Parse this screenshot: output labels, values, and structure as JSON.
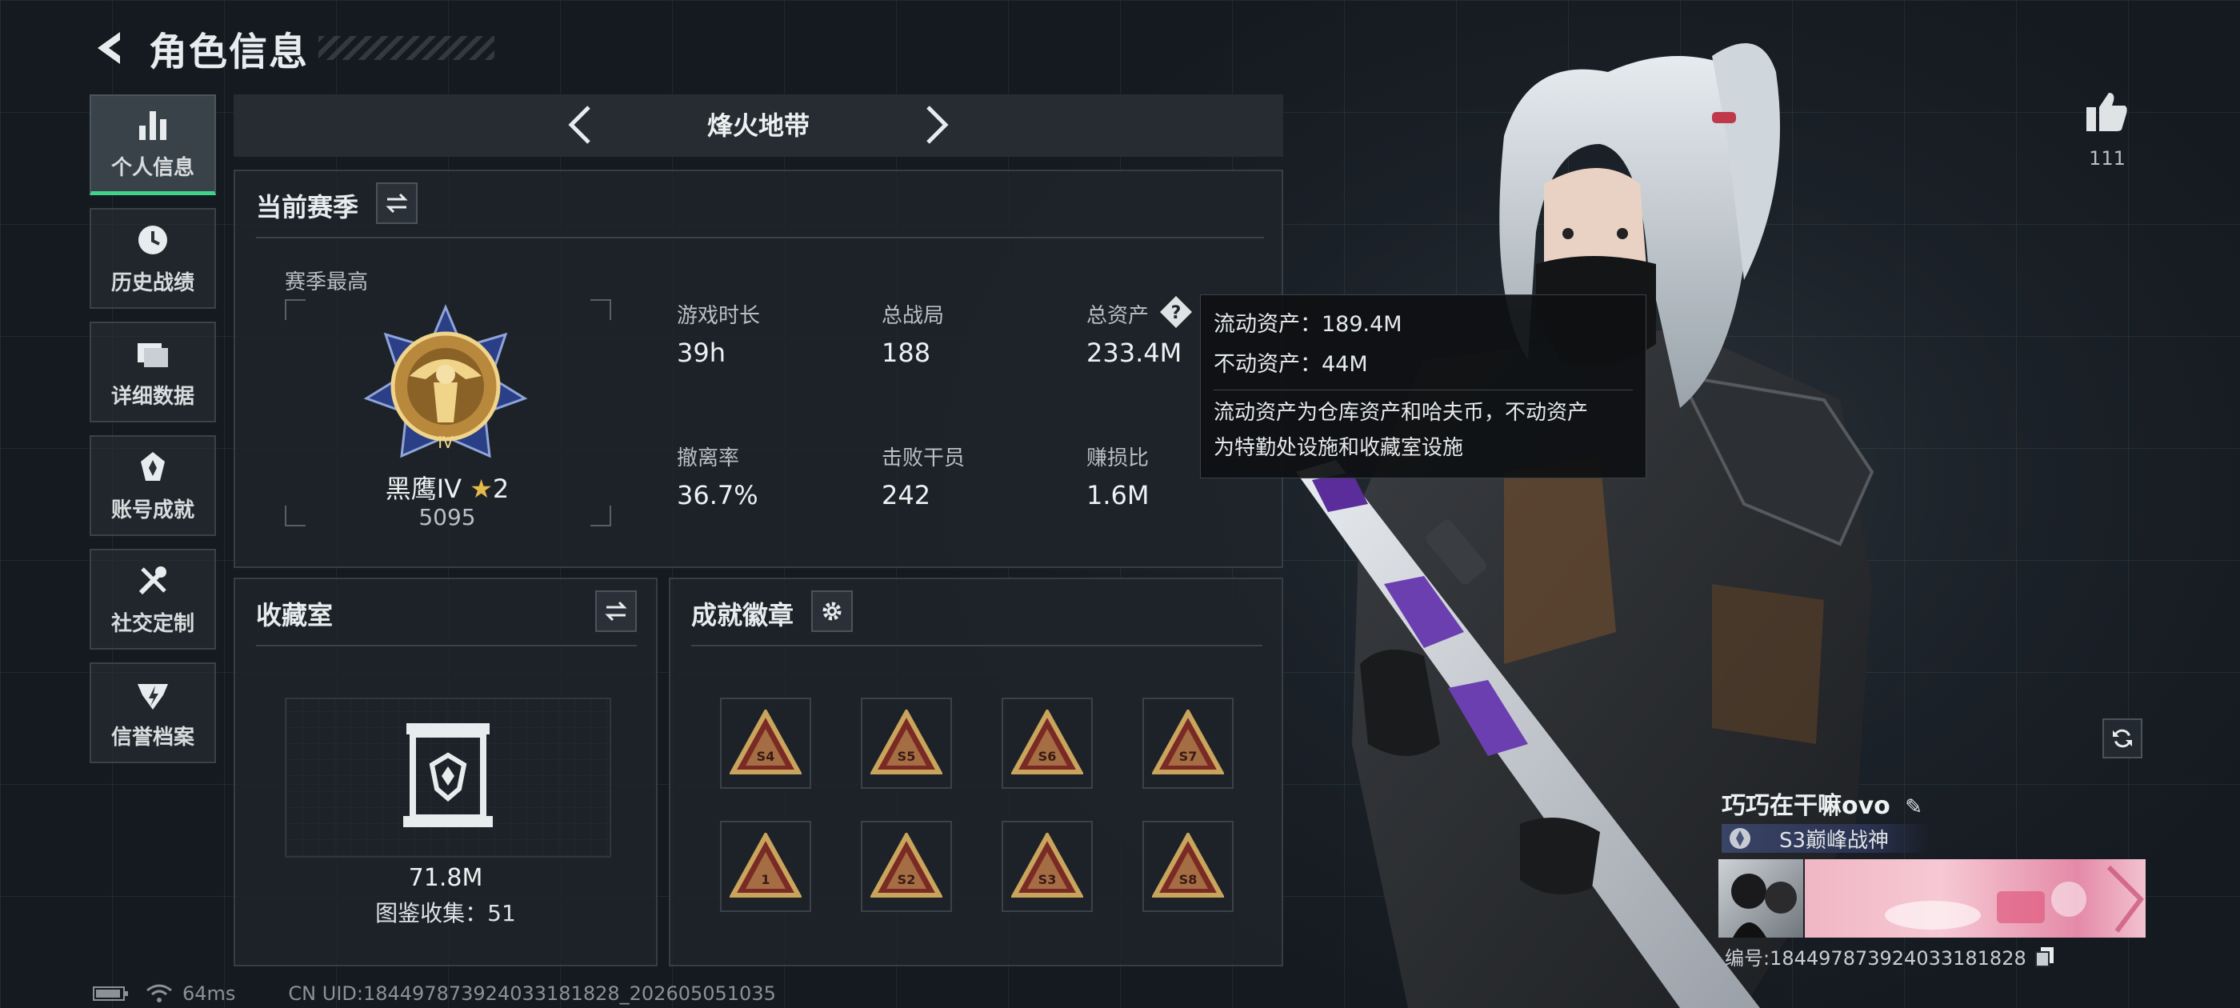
{
  "header": {
    "title": "角色信息"
  },
  "sidebar": {
    "items": [
      {
        "label": "个人信息"
      },
      {
        "label": "历史战绩"
      },
      {
        "label": "详细数据"
      },
      {
        "label": "账号成就"
      },
      {
        "label": "社交定制"
      },
      {
        "label": "信誉档案"
      }
    ]
  },
  "mode": {
    "title": "烽火地带"
  },
  "season": {
    "title": "当前赛季",
    "best_label": "赛季最高",
    "rank_name": "黑鹰IV",
    "rank_stars": "2",
    "rank_score": "5095",
    "stats": [
      {
        "label": "游戏时长",
        "value": "39h"
      },
      {
        "label": "总战局",
        "value": "188"
      },
      {
        "label": "总资产",
        "value": "233.4M"
      },
      {
        "label": "撤离率",
        "value": "36.7%"
      },
      {
        "label": "击败干员",
        "value": "242"
      },
      {
        "label": "赚损比",
        "value": "1.6M"
      }
    ]
  },
  "tooltip": {
    "liquid": "流动资产：189.4M",
    "fixed": "不动资产：44M",
    "desc1": "流动资产为仓库资产和哈夫币，不动资产",
    "desc2": "为特勤处设施和收藏室设施"
  },
  "collection": {
    "title": "收藏室",
    "value": "71.8M",
    "count": "图鉴收集：51"
  },
  "achievements": {
    "title": "成就徽章",
    "badges": [
      "S4",
      "S5",
      "S6",
      "S7",
      "1",
      "S2",
      "S3",
      "S8"
    ]
  },
  "profile": {
    "likes": "111",
    "name": "巧巧在干嘛ovo",
    "title": "S3巅峰战神",
    "id": "编号:1844978739240331818​28"
  },
  "status": {
    "ping": "64ms",
    "uid": "CN UID:1844978739240331818​28_202605051035"
  },
  "colors": {
    "accent": "#3ed58b",
    "badge_gold": "#c9a45c",
    "badge_red": "#7a2a24"
  }
}
